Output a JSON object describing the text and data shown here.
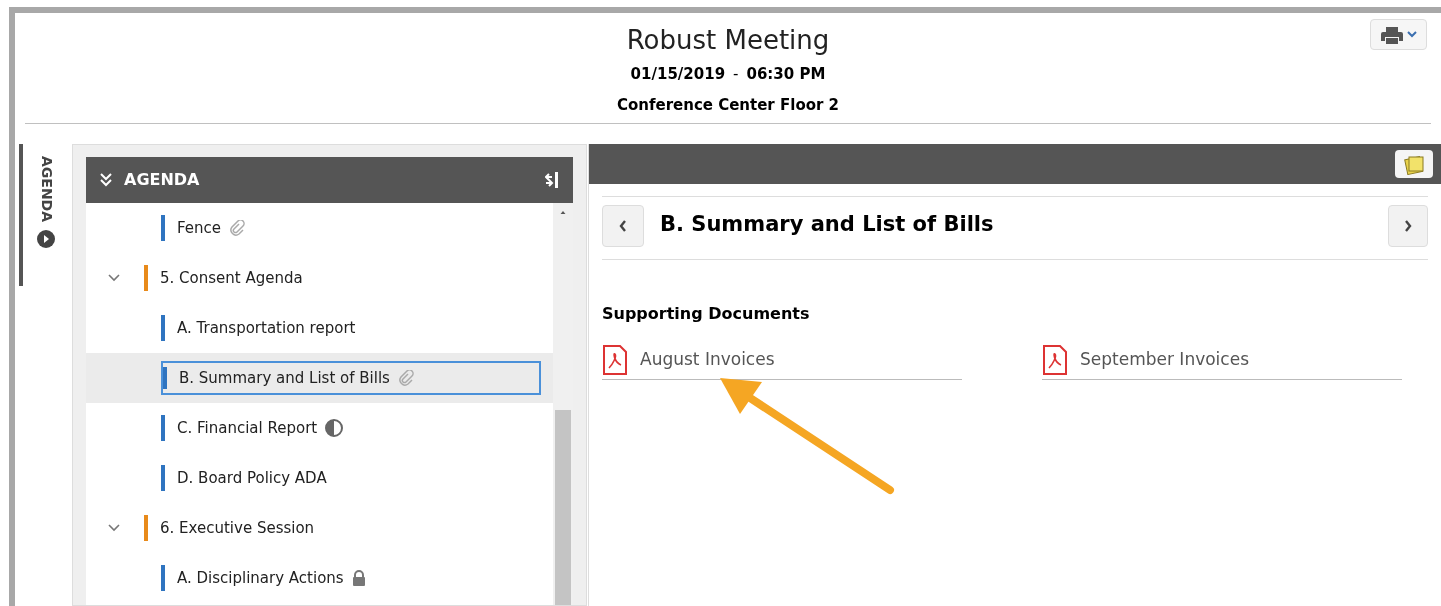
{
  "meeting": {
    "title": "Robust Meeting",
    "date": "01/15/2019",
    "separator": "-",
    "time": "06:30 PM",
    "location": "Conference Center Floor 2"
  },
  "side_tab": {
    "label": "AGENDA"
  },
  "agenda": {
    "title": "AGENDA",
    "items": [
      {
        "kind": "attachment",
        "label": "Fence",
        "selected": false
      },
      {
        "kind": "section",
        "label": "5. Consent Agenda",
        "expanded": true,
        "selected": false,
        "children": [
          {
            "kind": "plain",
            "label": "A. Transportation report",
            "selected": false
          },
          {
            "kind": "attachment",
            "label": "B. Summary and List of Bills",
            "selected": true
          },
          {
            "kind": "partial",
            "label": "C. Financial Report",
            "selected": false
          },
          {
            "kind": "plain",
            "label": "D. Board Policy ADA",
            "selected": false
          }
        ]
      },
      {
        "kind": "section",
        "label": "6. Executive Session",
        "expanded": true,
        "selected": false,
        "children": [
          {
            "kind": "locked",
            "label": "A. Disciplinary Actions",
            "selected": false
          }
        ]
      }
    ]
  },
  "detail": {
    "title": "B. Summary and List of Bills",
    "documents_heading": "Supporting Documents",
    "documents": [
      "August Invoices",
      "September Invoices"
    ]
  }
}
